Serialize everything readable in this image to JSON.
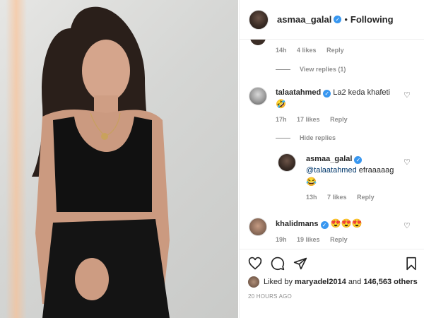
{
  "post": {
    "author": "asmaa_galal",
    "follow_status": "Following",
    "verified_mark": "✓"
  },
  "comments": [
    {
      "id": "c0",
      "time": "14h",
      "likes": "4 likes",
      "reply_label": "Reply",
      "toggle_replies": "View replies (1)"
    },
    {
      "id": "c1",
      "username": "talaatahmed",
      "text": "La2 keda khafeti",
      "emoji": "🤣",
      "time": "17h",
      "likes": "17 likes",
      "reply_label": "Reply",
      "toggle_replies": "Hide replies",
      "reply": {
        "username": "asmaa_galal",
        "mention": "@talaatahmed",
        "text": "efraaaaag",
        "emoji": "😂",
        "time": "13h",
        "likes": "7 likes",
        "reply_label": "Reply"
      }
    },
    {
      "id": "c2",
      "username": "khalidmans",
      "emoji": "😍😍😍",
      "time": "19h",
      "likes": "19 likes",
      "reply_label": "Reply"
    }
  ],
  "footer": {
    "liked_by_prefix": "Liked by",
    "liked_by_user": "maryadel2014",
    "and": "and",
    "others_count": "146,563 others",
    "timestamp": "20 HOURS AGO"
  },
  "icons": {
    "like": "heart-icon",
    "comment": "comment-icon",
    "share": "share-icon",
    "save": "bookmark-icon",
    "comment_like": "heart-icon"
  },
  "colors": {
    "verified": "#3897f0",
    "mention": "#00376b",
    "muted": "#8e8e8e",
    "text": "#262626"
  }
}
